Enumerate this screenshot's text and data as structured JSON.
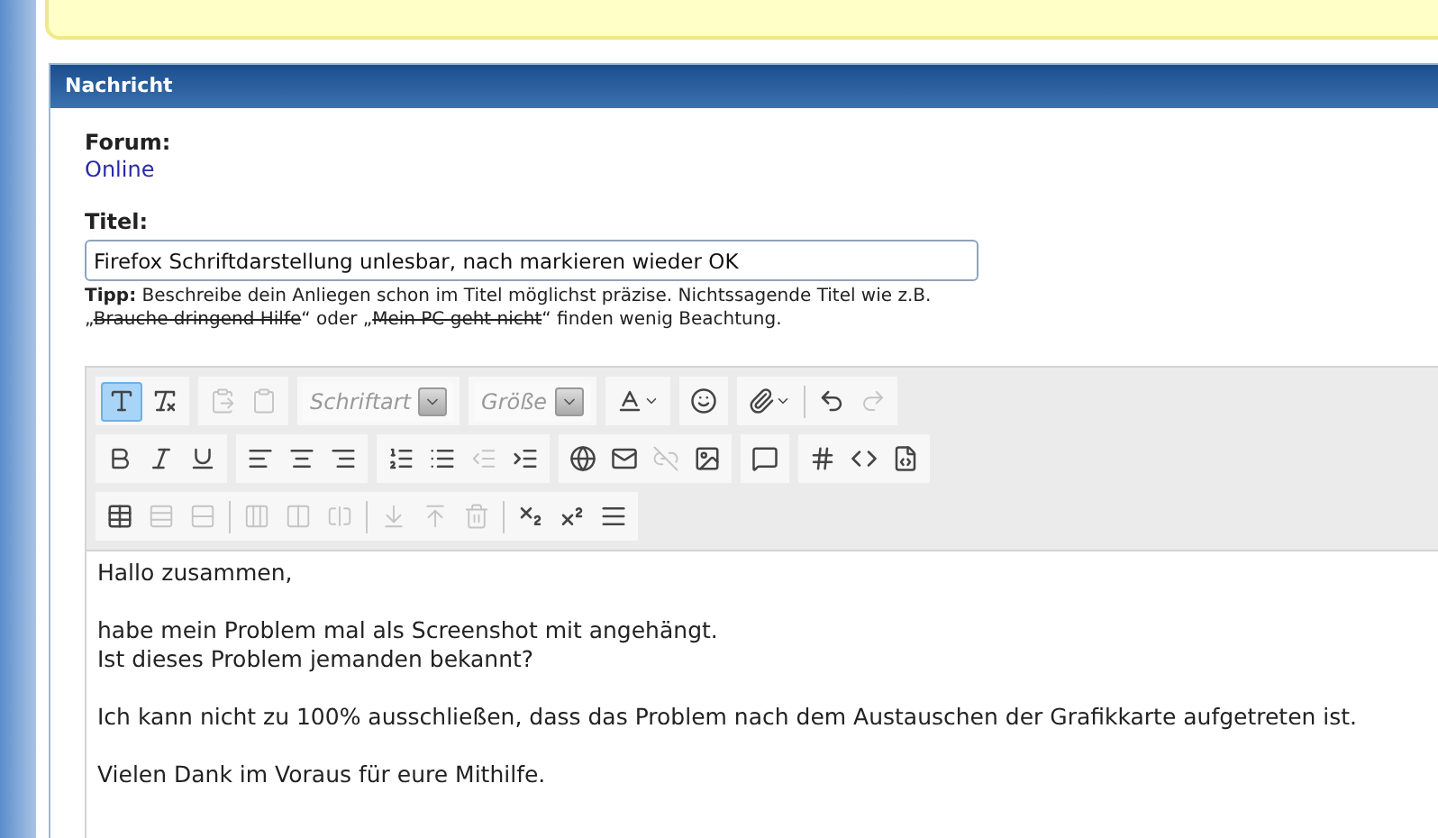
{
  "panel": {
    "title": "Nachricht"
  },
  "forum": {
    "label": "Forum:",
    "value": "Online"
  },
  "title_field": {
    "label": "Titel:",
    "value": "Firefox Schriftdarstellung unlesbar, nach markieren wieder OK"
  },
  "tip": {
    "label": "Tipp:",
    "parts": [
      {
        "text": " Beschreibe dein Anliegen schon im Titel möglichst präzise. Nichtssagende Titel wie z.B. „",
        "struck": false
      },
      {
        "text": "Brauche dringend Hilfe",
        "struck": true
      },
      {
        "text": "“ oder „",
        "struck": false
      },
      {
        "text": "Mein PC geht nicht",
        "struck": true
      },
      {
        "text": "“ finden wenig Beachtung.",
        "struck": false
      }
    ]
  },
  "toolbar": {
    "rows": [
      {
        "groups": [
          {
            "items": [
              {
                "kind": "button",
                "active": true,
                "disabled": false
              },
              {
                "kind": "button",
                "active": false,
                "disabled": false
              }
            ]
          },
          {
            "items": [
              {
                "kind": "button",
                "active": false,
                "disabled": true
              },
              {
                "kind": "button",
                "active": false,
                "disabled": true
              }
            ]
          },
          {
            "items": [
              {
                "kind": "select",
                "label": "Schriftart"
              }
            ]
          },
          {
            "items": [
              {
                "kind": "select",
                "label": "Größe"
              }
            ]
          },
          {
            "items": [
              {
                "kind": "menu",
                "active": false,
                "disabled": false
              }
            ]
          },
          {
            "items": [
              {
                "kind": "button",
                "active": false,
                "disabled": false
              }
            ]
          },
          {
            "items": [
              {
                "kind": "menu",
                "active": false,
                "disabled": false
              },
              {
                "kind": "separator"
              },
              {
                "kind": "button",
                "active": false,
                "disabled": false
              },
              {
                "kind": "button",
                "active": false,
                "disabled": true
              }
            ]
          }
        ]
      },
      {
        "groups": [
          {
            "items": [
              {
                "kind": "button",
                "active": false,
                "disabled": false
              },
              {
                "kind": "button",
                "active": false,
                "disabled": false
              },
              {
                "kind": "button",
                "active": false,
                "disabled": false
              }
            ]
          },
          {
            "items": [
              {
                "kind": "button",
                "active": false,
                "disabled": false
              },
              {
                "kind": "button",
                "active": false,
                "disabled": false
              },
              {
                "kind": "button",
                "active": false,
                "disabled": false
              }
            ]
          },
          {
            "items": [
              {
                "kind": "button",
                "active": false,
                "disabled": false
              },
              {
                "kind": "button",
                "active": false,
                "disabled": false
              },
              {
                "kind": "button",
                "active": false,
                "disabled": true
              },
              {
                "kind": "button",
                "active": false,
                "disabled": false
              }
            ]
          },
          {
            "items": [
              {
                "kind": "button",
                "active": false,
                "disabled": false
              },
              {
                "kind": "button",
                "active": false,
                "disabled": false
              },
              {
                "kind": "button",
                "active": false,
                "disabled": true
              },
              {
                "kind": "button",
                "active": false,
                "disabled": false
              }
            ]
          },
          {
            "items": [
              {
                "kind": "button",
                "active": false,
                "disabled": false
              }
            ]
          },
          {
            "items": [
              {
                "kind": "button",
                "active": false,
                "disabled": false
              },
              {
                "kind": "button",
                "active": false,
                "disabled": false
              },
              {
                "kind": "button",
                "active": false,
                "disabled": false
              }
            ]
          }
        ]
      },
      {
        "groups": [
          {
            "items": [
              {
                "kind": "button",
                "active": false,
                "disabled": false
              },
              {
                "kind": "button",
                "active": false,
                "disabled": true
              },
              {
                "kind": "button",
                "active": false,
                "disabled": true
              },
              {
                "kind": "separator"
              },
              {
                "kind": "button",
                "active": false,
                "disabled": true
              },
              {
                "kind": "button",
                "active": false,
                "disabled": true
              },
              {
                "kind": "button",
                "active": false,
                "disabled": true
              },
              {
                "kind": "separator"
              },
              {
                "kind": "button",
                "active": false,
                "disabled": true
              },
              {
                "kind": "button",
                "active": false,
                "disabled": true
              },
              {
                "kind": "button",
                "active": false,
                "disabled": true
              },
              {
                "kind": "separator"
              },
              {
                "kind": "button",
                "active": false,
                "disabled": false
              },
              {
                "kind": "button",
                "active": false,
                "disabled": false
              },
              {
                "kind": "button",
                "active": false,
                "disabled": false
              }
            ]
          }
        ]
      }
    ]
  },
  "editor": {
    "paragraphs": [
      [
        "Hallo zusammen,"
      ],
      [
        "habe mein Problem mal als Screenshot mit angehängt.",
        "Ist dieses Problem jemanden bekannt?"
      ],
      [
        "Ich kann nicht zu 100% ausschließen, dass das Problem nach dem Austauschen der Grafikkarte aufgetreten ist."
      ],
      [
        "Vielen Dank im Voraus für eure Mithilfe."
      ]
    ]
  }
}
